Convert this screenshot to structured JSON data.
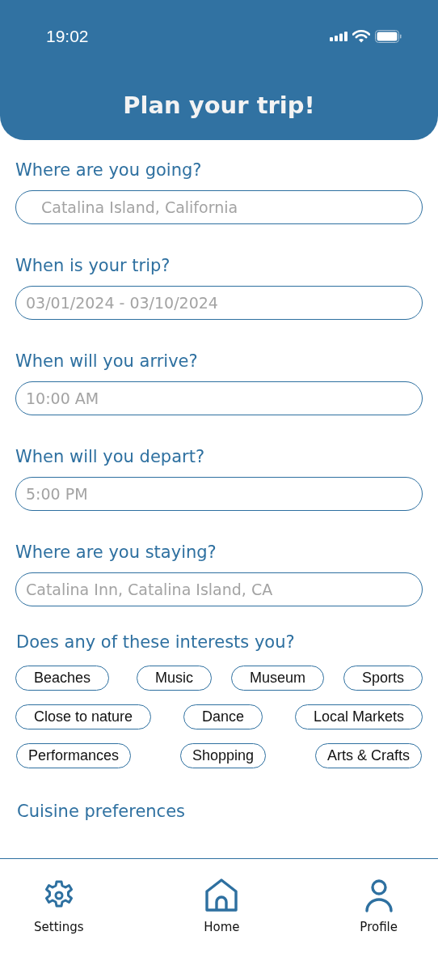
{
  "status_bar": {
    "time": "19:02"
  },
  "header": {
    "title": "Plan your trip!"
  },
  "fields": [
    {
      "label": "Where are you going?",
      "placeholder": "Catalina Island, California",
      "kind": "indented"
    },
    {
      "label": "When is your trip?",
      "placeholder": "03/01/2024 - 03/10/2024",
      "kind": "plain"
    },
    {
      "label": "When will you arrive?",
      "placeholder": "10:00 AM",
      "kind": "plain"
    },
    {
      "label": "When will you depart?",
      "placeholder": "5:00 PM",
      "kind": "plain"
    },
    {
      "label": "Where are you staying?",
      "placeholder": "Catalina Inn, Catalina Island, CA",
      "kind": "plain"
    }
  ],
  "interests": {
    "heading": "Does any of these interests you?",
    "rows": [
      [
        {
          "label": "Beaches",
          "selected": false
        },
        {
          "label": "Music",
          "selected": false
        },
        {
          "label": "Museum",
          "selected": false
        },
        {
          "label": "Sports",
          "selected": false
        }
      ],
      [
        {
          "label": "Close to nature",
          "selected": false
        },
        {
          "label": "Dance",
          "selected": false
        },
        {
          "label": "Local Markets",
          "selected": false
        }
      ],
      [
        {
          "label": "Performances",
          "selected": false
        },
        {
          "label": "Shopping",
          "selected": false
        },
        {
          "label": "Arts & Crafts",
          "selected": false
        }
      ]
    ]
  },
  "cuisine": {
    "heading": "Cuisine preferences"
  },
  "nav": [
    {
      "label": "Settings",
      "kind": "settings"
    },
    {
      "label": "Home",
      "kind": "home"
    },
    {
      "label": "Profile",
      "kind": "profile"
    }
  ]
}
